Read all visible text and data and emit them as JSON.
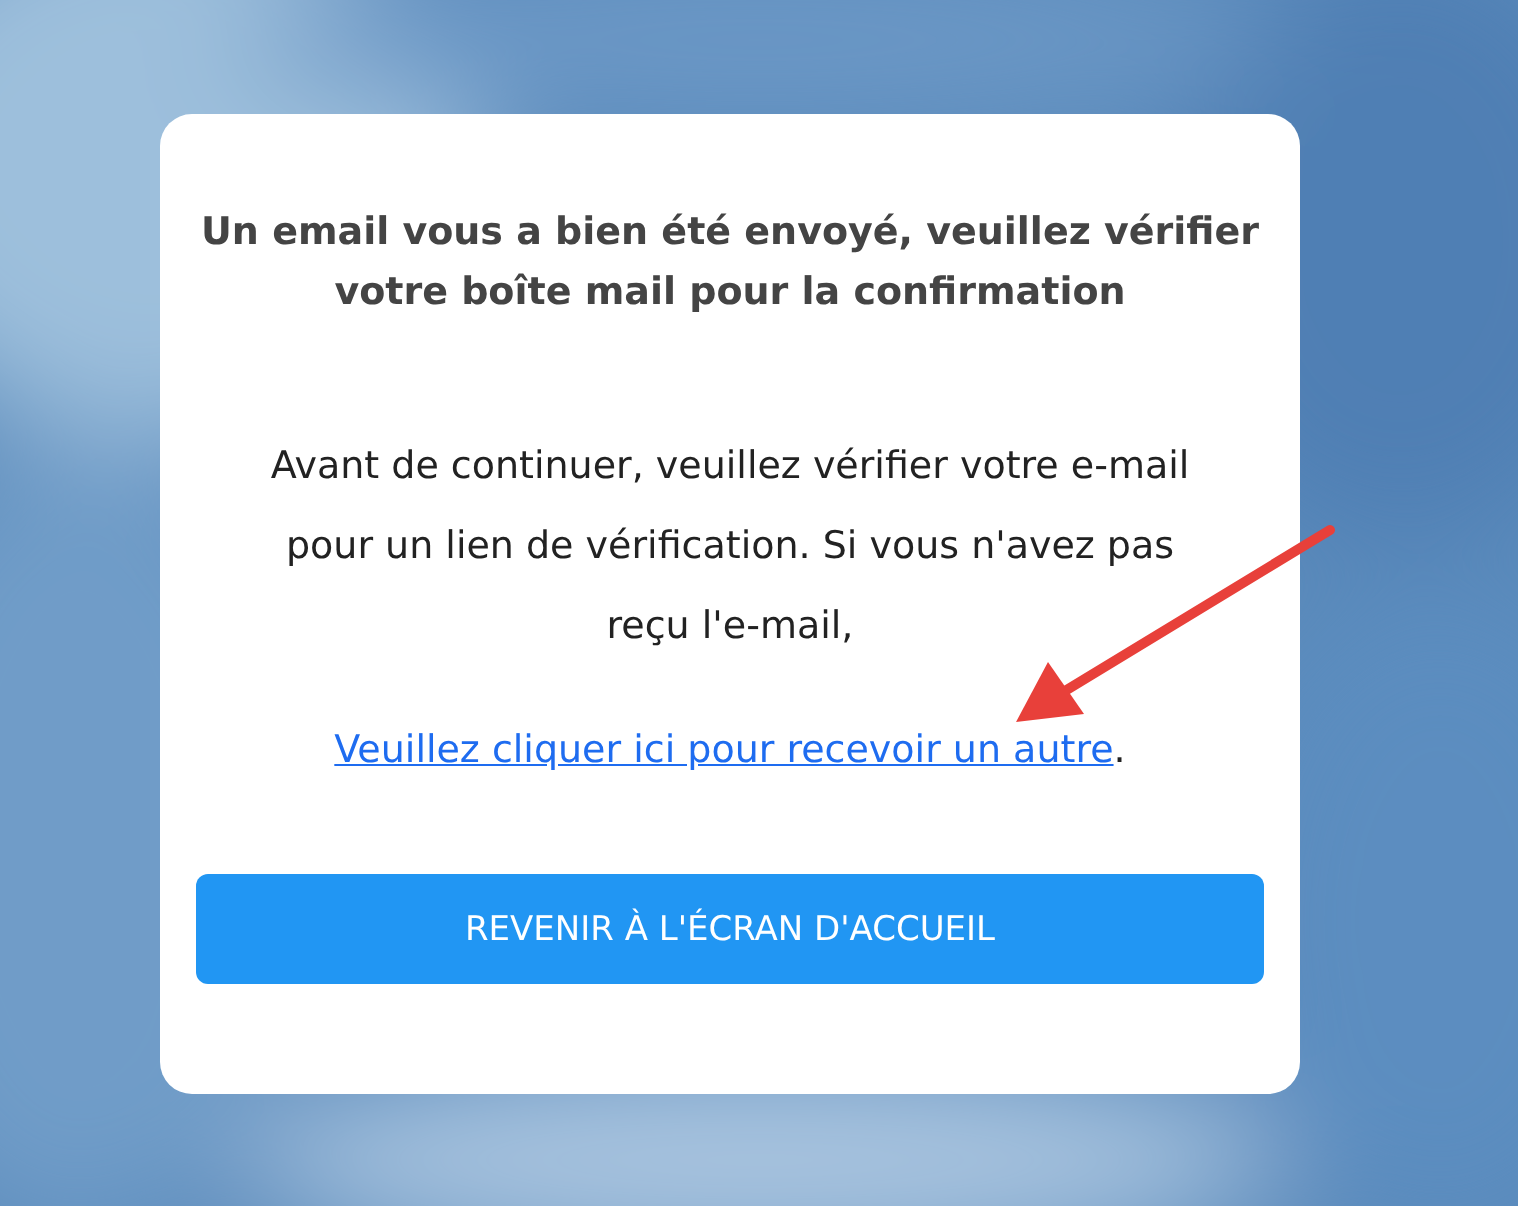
{
  "heading": "Un email vous a bien été envoyé, veuillez vérifier votre boîte mail pour la confirmation",
  "message": "Avant de continuer, veuillez vérifier votre e-mail pour un lien de vérification. Si vous n'avez pas reçu l'e-mail,",
  "resend": {
    "link": "Veuillez cliquer ici pour recevoir un autre",
    "suffix": "."
  },
  "button": "REVENIR À L'ÉCRAN D'ACCUEIL"
}
